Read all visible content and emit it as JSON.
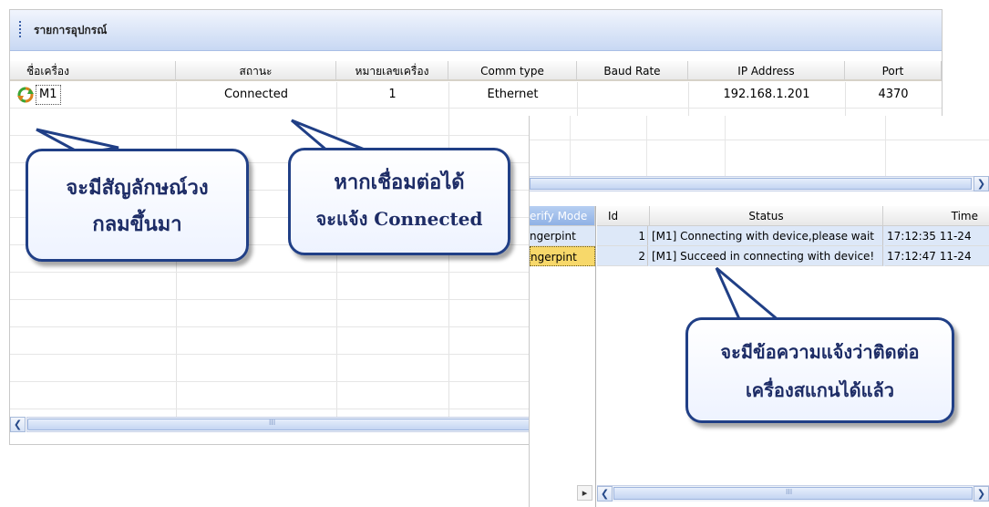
{
  "device_panel": {
    "title": "รายการอุปกรณ์",
    "columns": [
      "ชื่อเครื่อง",
      "สถานะ",
      "หมายเลขเครื่อง",
      "Comm type",
      "Baud Rate",
      "IP Address",
      "Port"
    ],
    "row": {
      "name": "M1",
      "status": "Connected",
      "number": "1",
      "comm_type": "Ethernet",
      "baud_rate": "",
      "ip": "192.168.1.201",
      "port": "4370"
    },
    "scroll_mark": "III"
  },
  "callouts": {
    "icon_note_line1": "จะมีสัญลักษณ์วง",
    "icon_note_line2": "กลมขึ้นมา",
    "status_note_line1": "หากเชื่อมต่อได้",
    "status_note_line2": "จะแจ้ง Connected",
    "log_note_line1": "จะมีข้อความแจ้งว่าติดต่อ",
    "log_note_line2": "เครื่องสแกนได้แล้ว"
  },
  "log_panel": {
    "left_header": "erify Mode",
    "left_rows": [
      "ngerpint",
      "ngerpint"
    ],
    "columns": [
      "Id",
      "Status",
      "Time"
    ],
    "rows": [
      {
        "id": "1",
        "status": "[M1] Connecting with device,please wait",
        "time": "17:12:35 11-24"
      },
      {
        "id": "2",
        "status": "[M1] Succeed in connecting with device!",
        "time": "17:12:47 11-24"
      }
    ],
    "scroll_mark": "III"
  },
  "colors": {
    "header_gradient_top": "#f1f5fd",
    "header_gradient_bottom": "#c8d8f3",
    "callout_border": "#203f86",
    "selected_row": "#f7d86a",
    "row_highlight": "#dde8f8"
  },
  "icons": {
    "connected": "refresh-icon",
    "scroll_left": "chevron-left-icon",
    "scroll_right": "chevron-right-icon"
  }
}
